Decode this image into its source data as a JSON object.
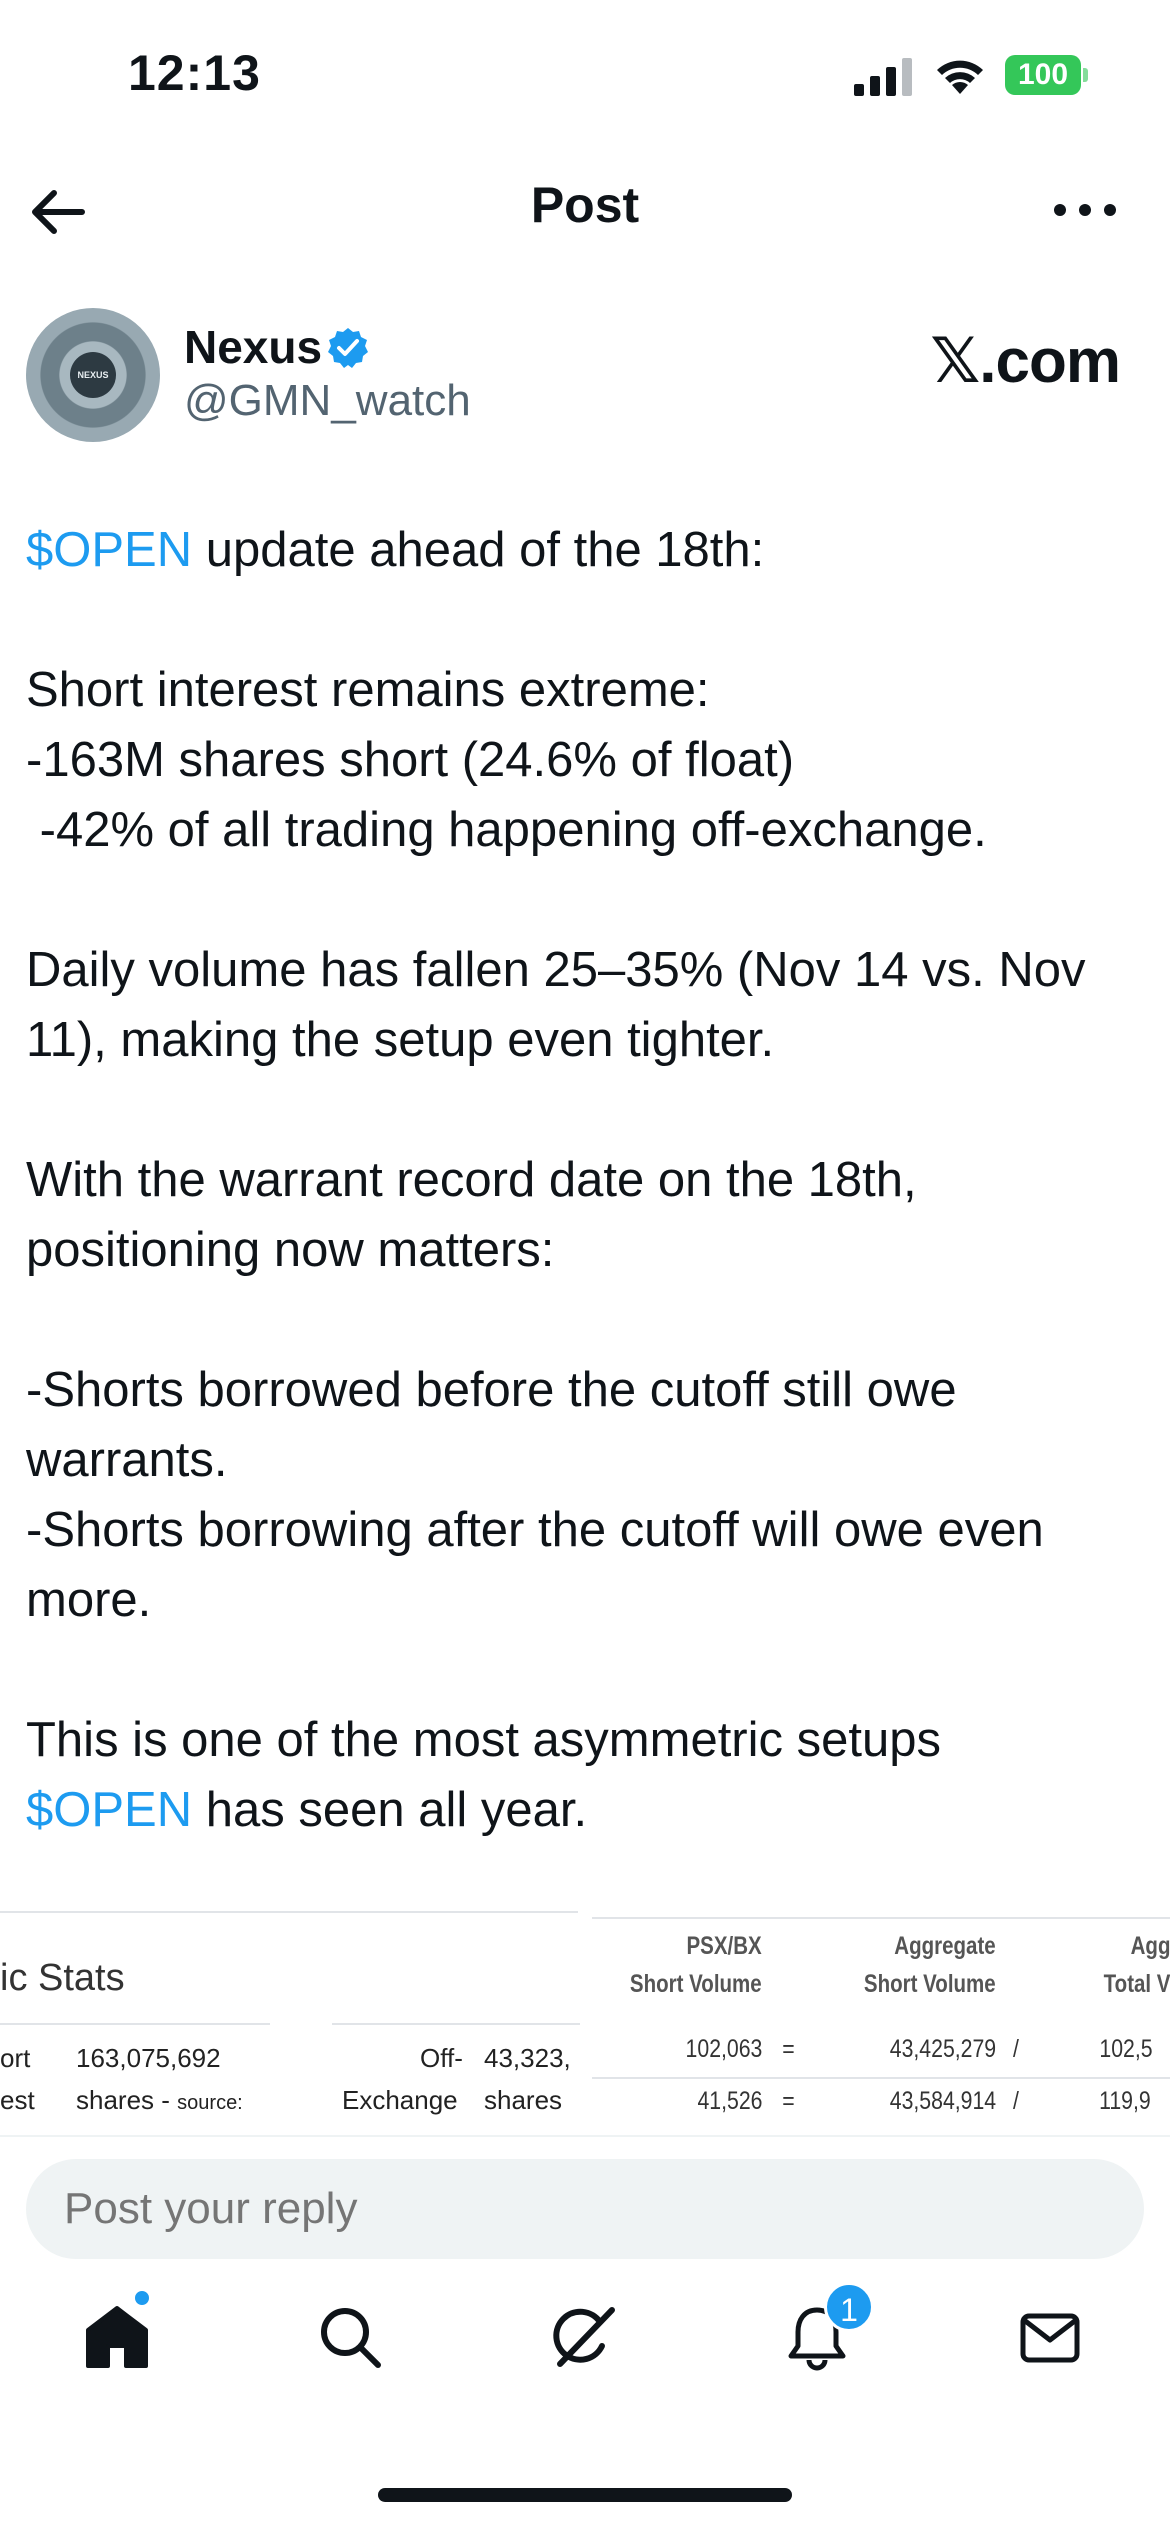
{
  "status_bar": {
    "time": "12:13",
    "battery": "100"
  },
  "header": {
    "title": "Post"
  },
  "author": {
    "name": "Nexus",
    "handle": "@GMN_watch",
    "avatar_text": "NEXUS",
    "source_label": "𝕏.com"
  },
  "post": {
    "segments": [
      {
        "text": "$OPEN",
        "type": "cashtag"
      },
      {
        "text": " update ahead of the 18th:\n\nShort interest remains extreme:\n-163M shares short (24.6% of float)\n -42% of all trading happening off-exchange.\n\nDaily volume has fallen 25–35% (Nov 14 vs. Nov 11), making the setup even tighter.\n\nWith the warrant record date on the 18th, positioning now matters:\n\n-Shorts borrowed before the cutoff still owe warrants.\n-Shorts borrowing after the cutoff will owe even more.\n\nThis is one of the most asymmetric setups\n",
        "type": "text"
      },
      {
        "text": "$OPEN",
        "type": "cashtag"
      },
      {
        "text": " has seen all year.",
        "type": "text"
      }
    ]
  },
  "media": {
    "left_title": "ic Stats",
    "left_row1": [
      "ort",
      "163,075,692",
      "Off-",
      "43,323,"
    ],
    "left_row2": [
      "est",
      "shares - ",
      "source:",
      "Exchange",
      "shares"
    ],
    "headers": [
      {
        "line1": "PSX/BX",
        "line2": "Short Volume"
      },
      {
        "line1": "Aggregate",
        "line2": "Short Volume"
      },
      {
        "line1": "Agg",
        "line2": "Total V"
      }
    ],
    "rows": [
      {
        "psx": "102,063",
        "op1": "=",
        "agg": "43,425,279",
        "op2": "/",
        "total": "102,5"
      },
      {
        "psx": "41,526",
        "op1": "=",
        "agg": "43,584,914",
        "op2": "/",
        "total": "119,9"
      }
    ]
  },
  "reply": {
    "placeholder": "Post your reply"
  },
  "tabs": {
    "notifications_badge": "1"
  },
  "colors": {
    "accent": "#1d9bf0",
    "text": "#0f1419",
    "secondary": "#536471",
    "battery": "#34c759"
  }
}
